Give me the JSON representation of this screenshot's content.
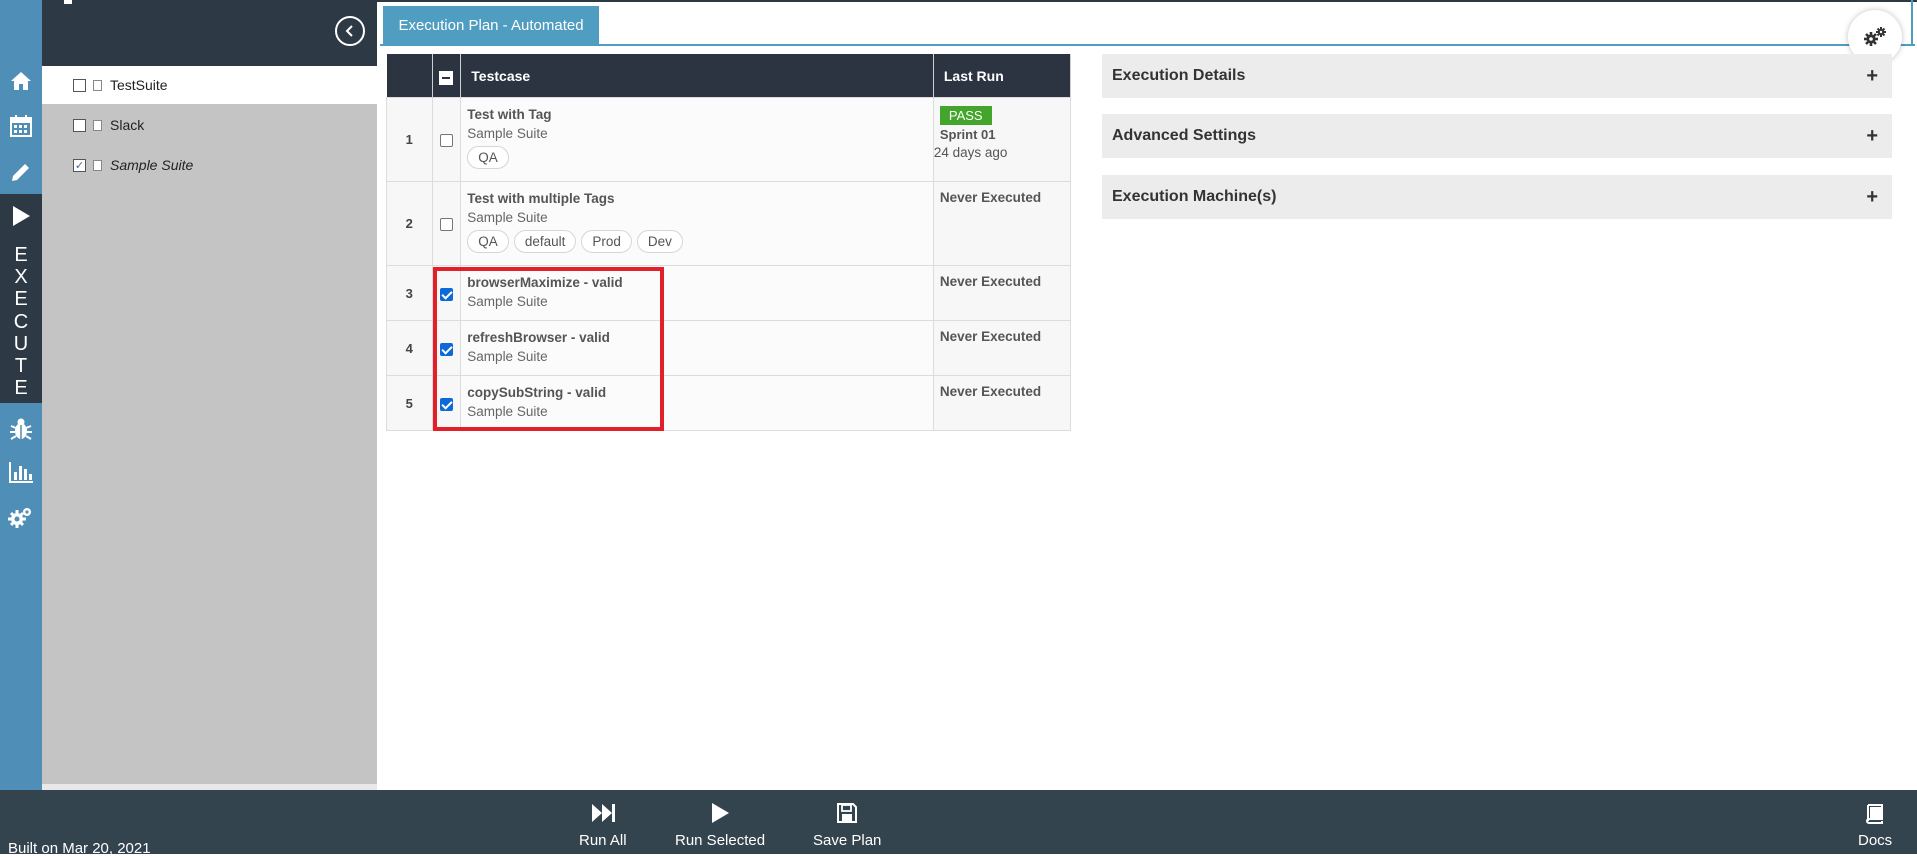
{
  "tab": {
    "label": "Execution Plan - Automated"
  },
  "sidebar": {
    "execute_label": [
      "E",
      "X",
      "E",
      "C",
      "U",
      "T",
      "E"
    ],
    "icons": [
      "home-icon",
      "calendar-icon",
      "pencil-icon",
      "play-icon",
      "bug-icon",
      "bar-chart-icon",
      "gears-icon"
    ]
  },
  "tree": {
    "items": [
      {
        "label": "TestSuite",
        "checked": false,
        "selected": true
      },
      {
        "label": "Slack",
        "checked": false,
        "selected": false
      },
      {
        "label": "Sample Suite",
        "checked": true,
        "selected": false
      }
    ]
  },
  "table": {
    "headers": {
      "testcase": "Testcase",
      "last_run": "Last Run"
    },
    "rows": [
      {
        "num": "1",
        "name": "Test with Tag",
        "suite": "Sample Suite",
        "tags": [
          "QA"
        ],
        "checked": false,
        "last_run": {
          "status": "PASS",
          "sprint": "Sprint 01",
          "ago": "24 days ago"
        }
      },
      {
        "num": "2",
        "name": "Test with multiple Tags",
        "suite": "Sample Suite",
        "tags": [
          "QA",
          "default",
          "Prod",
          "Dev"
        ],
        "checked": false,
        "last_run": {
          "text": "Never Executed"
        }
      },
      {
        "num": "3",
        "name": "browserMaximize - valid",
        "suite": "Sample Suite",
        "checked": true,
        "last_run": {
          "text": "Never Executed"
        }
      },
      {
        "num": "4",
        "name": "refreshBrowser - valid",
        "suite": "Sample Suite",
        "checked": true,
        "last_run": {
          "text": "Never Executed"
        }
      },
      {
        "num": "5",
        "name": "copySubString - valid",
        "suite": "Sample Suite",
        "checked": true,
        "last_run": {
          "text": "Never Executed"
        }
      }
    ]
  },
  "accordion": [
    {
      "label": "Execution Details",
      "icon": "+"
    },
    {
      "label": "Advanced Settings",
      "icon": "+"
    },
    {
      "label": "Execution Machine(s)",
      "icon": "+"
    }
  ],
  "footer": {
    "built": "Built on Mar 20, 2021",
    "run_all": "Run All",
    "run_selected": "Run Selected",
    "save_plan": "Save Plan",
    "docs": "Docs"
  },
  "colors": {
    "accent": "#4f9dc0",
    "dark": "#2d3a46",
    "pass": "#43a52b",
    "highlight": "#e2202c"
  }
}
